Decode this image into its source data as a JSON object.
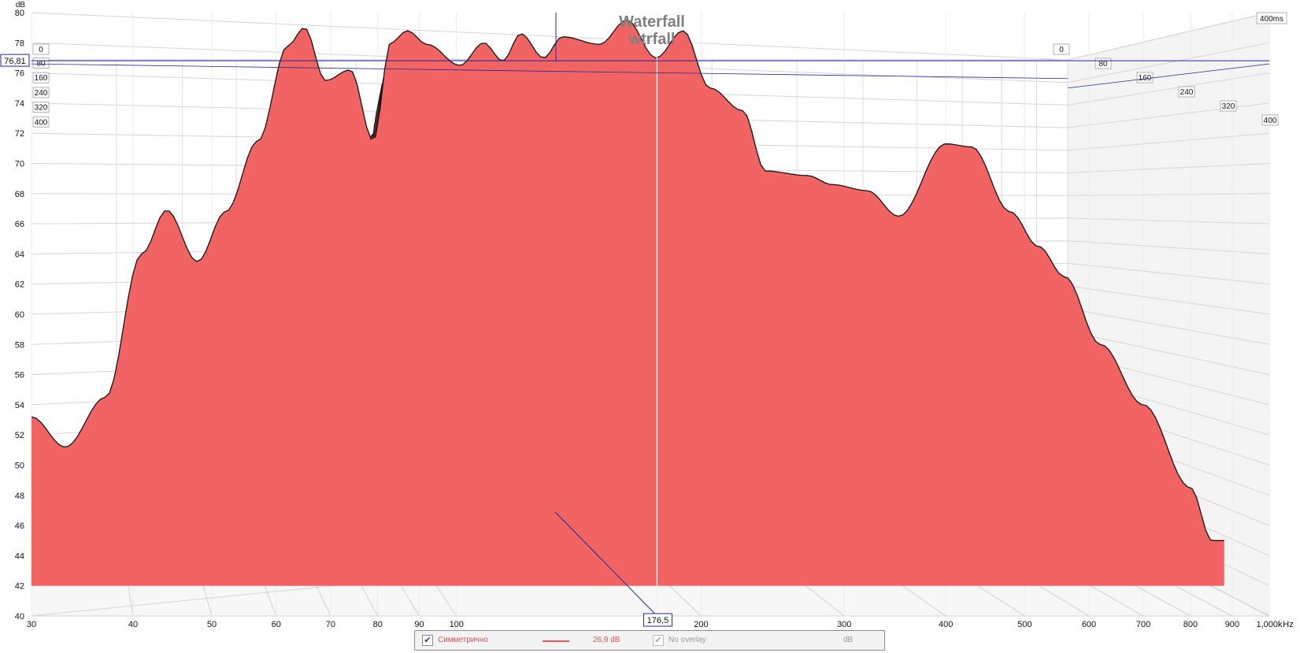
{
  "chart_data": {
    "type": "waterfall",
    "title": "Waterfall",
    "subtitle": "wtrfall",
    "ylabel": "dB",
    "xlabel": "Hz",
    "ylim": [
      40,
      80
    ],
    "yticks": [
      "80",
      "78",
      "76",
      "74",
      "72",
      "70",
      "68",
      "66",
      "64",
      "62",
      "60",
      "58",
      "56",
      "54",
      "52",
      "50",
      "48",
      "46",
      "44",
      "42",
      "40"
    ],
    "xlim": [
      30,
      1000
    ],
    "x_scale": "log",
    "xticks": [
      {
        "value": 30,
        "label": "30"
      },
      {
        "value": 40,
        "label": "40"
      },
      {
        "value": 50,
        "label": "50"
      },
      {
        "value": 60,
        "label": "60"
      },
      {
        "value": 70,
        "label": "70"
      },
      {
        "value": 80,
        "label": "80"
      },
      {
        "value": 90,
        "label": "90"
      },
      {
        "value": 100,
        "label": "100"
      },
      {
        "value": 200,
        "label": "200"
      },
      {
        "value": 300,
        "label": "300"
      },
      {
        "value": 400,
        "label": "400"
      },
      {
        "value": 500,
        "label": "500"
      },
      {
        "value": 600,
        "label": "600"
      },
      {
        "value": 700,
        "label": "700"
      },
      {
        "value": 800,
        "label": "800"
      },
      {
        "value": 900,
        "label": "900"
      },
      {
        "value": 1000,
        "label": "1,000k"
      }
    ],
    "time_axis_label": "400ms",
    "time_ticks": [
      {
        "value": 0,
        "label": "0"
      },
      {
        "value": 80,
        "label": "80"
      },
      {
        "value": 160,
        "label": "160"
      },
      {
        "value": 240,
        "label": "240"
      },
      {
        "value": 320,
        "label": "320"
      },
      {
        "value": 400,
        "label": "400"
      }
    ],
    "cursor": {
      "frequency": 176.5,
      "frequency_label": "176,5",
      "level": 76.81,
      "level_label": "76,81"
    },
    "slice_count": 40,
    "fill_color": "#f26464",
    "edge_color": "#141414",
    "grid": true,
    "front_slice": [
      {
        "f": 30,
        "db": 53.2
      },
      {
        "f": 33,
        "db": 51.2
      },
      {
        "f": 37,
        "db": 54.5
      },
      {
        "f": 41,
        "db": 64.0
      },
      {
        "f": 44,
        "db": 66.9
      },
      {
        "f": 48,
        "db": 63.5
      },
      {
        "f": 52,
        "db": 66.8
      },
      {
        "f": 57,
        "db": 71.5
      },
      {
        "f": 62,
        "db": 77.8
      },
      {
        "f": 65,
        "db": 79.0
      },
      {
        "f": 69,
        "db": 75.5
      },
      {
        "f": 74,
        "db": 76.2
      },
      {
        "f": 79,
        "db": 71.5
      },
      {
        "f": 83,
        "db": 78.0
      },
      {
        "f": 87,
        "db": 78.8
      },
      {
        "f": 92,
        "db": 77.9
      },
      {
        "f": 101,
        "db": 76.5
      },
      {
        "f": 108,
        "db": 78.0
      },
      {
        "f": 114,
        "db": 76.8
      },
      {
        "f": 120,
        "db": 78.6
      },
      {
        "f": 128,
        "db": 77.0
      },
      {
        "f": 135,
        "db": 78.4
      },
      {
        "f": 150,
        "db": 77.9
      },
      {
        "f": 162,
        "db": 79.5
      },
      {
        "f": 176,
        "db": 77.0
      },
      {
        "f": 190,
        "db": 78.8
      },
      {
        "f": 205,
        "db": 75.0
      },
      {
        "f": 225,
        "db": 73.5
      },
      {
        "f": 240,
        "db": 69.5
      },
      {
        "f": 270,
        "db": 69.2
      },
      {
        "f": 290,
        "db": 68.6
      },
      {
        "f": 320,
        "db": 68.2
      },
      {
        "f": 350,
        "db": 66.5
      },
      {
        "f": 400,
        "db": 71.3
      },
      {
        "f": 430,
        "db": 71.1
      },
      {
        "f": 480,
        "db": 66.8
      },
      {
        "f": 520,
        "db": 64.5
      },
      {
        "f": 560,
        "db": 62.5
      },
      {
        "f": 620,
        "db": 58.0
      },
      {
        "f": 700,
        "db": 54.0
      },
      {
        "f": 800,
        "db": 48.5
      },
      {
        "f": 850,
        "db": 45.0
      }
    ]
  },
  "legend": {
    "items": [
      {
        "label": "Симметрично",
        "checked": true,
        "value": "26,9 dB",
        "color": "#ee5555"
      },
      {
        "label": "No overlay",
        "checked": true,
        "disabled": true,
        "value": "dB",
        "color": "#999999"
      }
    ]
  }
}
